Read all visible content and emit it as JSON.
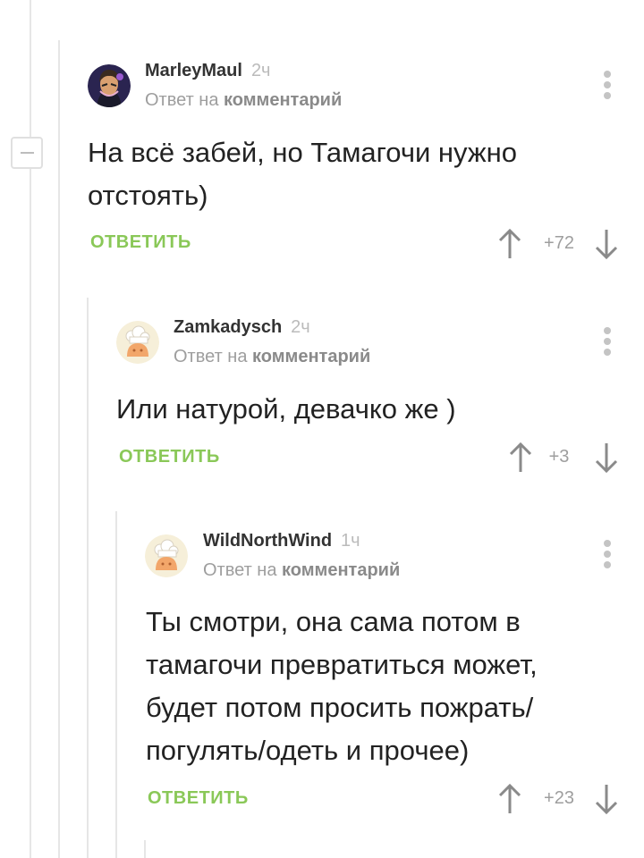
{
  "comments": [
    {
      "author": "MarleyMaul",
      "time": "2ч",
      "reply_prefix": "Ответ на",
      "reply_target": "комментарий",
      "text": "На всё забей, но Тамагочи нужно отстоять)",
      "reply_label": "ОТВЕТИТЬ",
      "score": "+72",
      "avatar": "portrait-avatar"
    },
    {
      "author": "Zamkadysch",
      "time": "2ч",
      "reply_prefix": "Ответ на",
      "reply_target": "комментарий",
      "text": "Или натурой, девачко же )",
      "reply_label": "ОТВЕТИТЬ",
      "score": "+3",
      "avatar": "chef-avatar"
    },
    {
      "author": "WildNorthWind",
      "time": "1ч",
      "reply_prefix": "Ответ на",
      "reply_target": "комментарий",
      "text": "Ты смотри, она сама потом в тамагочи превратиться может, будет потом просить пожрать/ погулять/одеть и прочее)",
      "reply_label": "ОТВЕТИТЬ",
      "score": "+23",
      "avatar": "chef-avatar"
    }
  ],
  "colors": {
    "accent_green": "#8ac858",
    "muted_text": "#9e9e9e",
    "thread_line": "#e6e6e6"
  }
}
